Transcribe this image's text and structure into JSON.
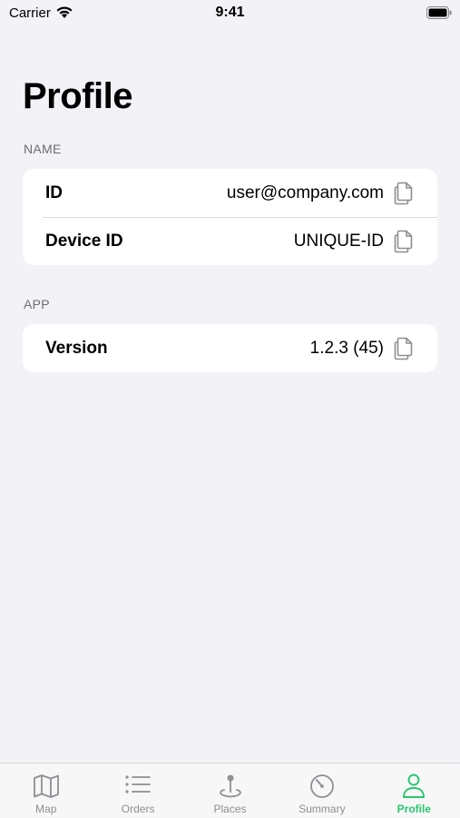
{
  "status_bar": {
    "carrier": "Carrier",
    "time": "9:41"
  },
  "page": {
    "title": "Profile"
  },
  "sections": [
    {
      "header": "NAME",
      "rows": [
        {
          "label": "ID",
          "value": "user@company.com"
        },
        {
          "label": "Device ID",
          "value": "UNIQUE-ID"
        }
      ]
    },
    {
      "header": "APP",
      "rows": [
        {
          "label": "Version",
          "value": "1.2.3 (45)"
        }
      ]
    }
  ],
  "tab_bar": {
    "active": "Profile",
    "accent_color": "#27c76f",
    "inactive_color": "#8e8e93",
    "tabs": [
      {
        "label": "Map",
        "icon": "map-icon"
      },
      {
        "label": "Orders",
        "icon": "list-icon"
      },
      {
        "label": "Places",
        "icon": "pin-icon"
      },
      {
        "label": "Summary",
        "icon": "timer-icon"
      },
      {
        "label": "Profile",
        "icon": "person-icon"
      }
    ]
  }
}
